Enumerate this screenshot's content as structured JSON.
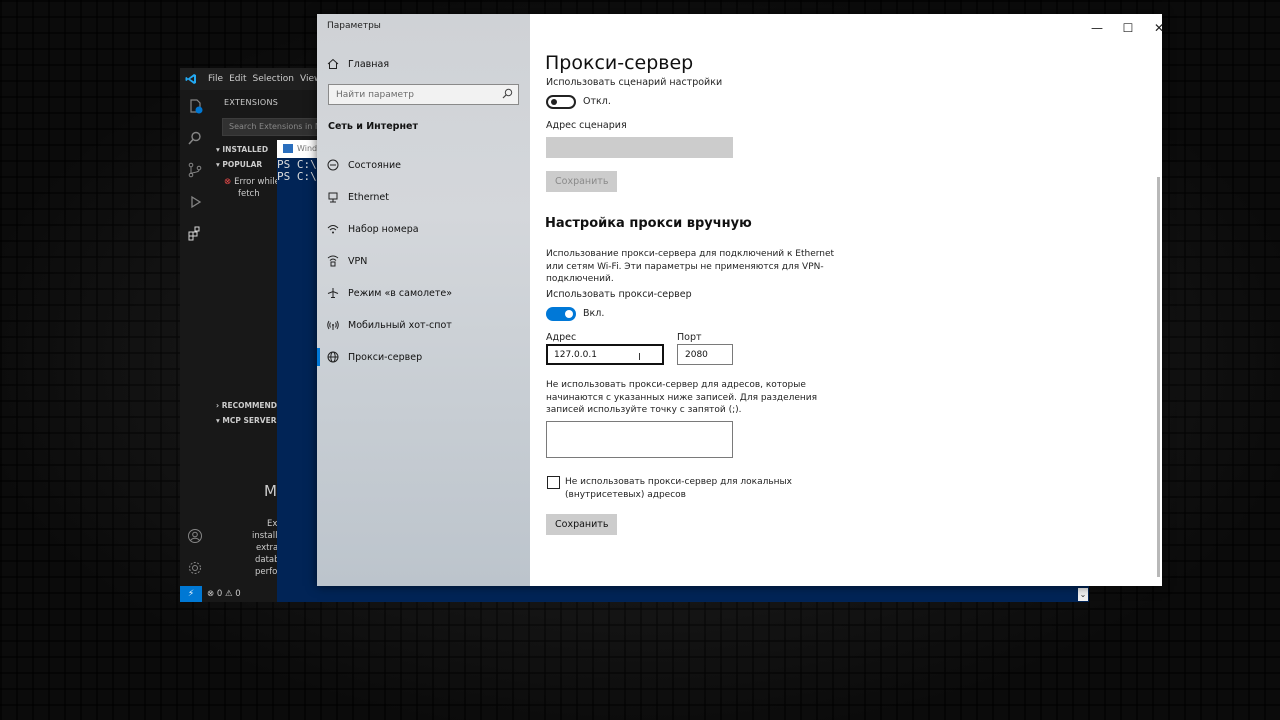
{
  "vscode": {
    "menu": [
      "File",
      "Edit",
      "Selection",
      "View"
    ],
    "extensions_title": "EXTENSIONS",
    "search_placeholder": "Search Extensions in M",
    "installed_label": "INSTALLED",
    "popular_label": "POPULAR",
    "error_line1": "Error while",
    "error_line2": "fetch",
    "recommended_label": "RECOMMENDED",
    "mcp_label": "MCP SERVERS",
    "frag_heading": "M",
    "frag_lines": [
      "Ext",
      "installi",
      "extra",
      "datab",
      "perfo"
    ],
    "status_errors": "0",
    "status_warnings": "0",
    "account_icon": "account-icon",
    "settings_icon": "gear-icon"
  },
  "powershell": {
    "tab_title": "Wind",
    "lines": "PS C:\\\nPS C:\\"
  },
  "settings": {
    "window_title": "Параметры",
    "home": "Главная",
    "search_placeholder": "Найти параметр",
    "category": "Сеть и Интернет",
    "nav_items": [
      {
        "label": "Состояние",
        "icon": "status-icon"
      },
      {
        "label": "Ethernet",
        "icon": "ethernet-icon"
      },
      {
        "label": "Набор номера",
        "icon": "dialup-icon"
      },
      {
        "label": "VPN",
        "icon": "vpn-icon"
      },
      {
        "label": "Режим «в самолете»",
        "icon": "airplane-icon"
      },
      {
        "label": "Мобильный хот-спот",
        "icon": "hotspot-icon"
      },
      {
        "label": "Прокси-сервер",
        "icon": "proxy-icon"
      }
    ],
    "selected_item": "Прокси-сервер",
    "page_title": "Прокси-сервер",
    "script_toggle_label": "Использовать сценарий настройки",
    "script_toggle_state": "Откл.",
    "script_address_label": "Адрес сценария",
    "script_save_button": "Сохранить",
    "manual_title": "Настройка прокси вручную",
    "manual_desc": "Использование прокси-сервера для подключений к Ethernet или сетям Wi-Fi. Эти параметры не применяются для VPN-подключений.",
    "use_proxy_label": "Использовать прокси-сервер",
    "use_proxy_state": "Вкл.",
    "address_label": "Адрес",
    "address_value": "127.0.0.1",
    "port_label": "Порт",
    "port_value": "2080",
    "exceptions_desc": "Не использовать прокси-сервер для адресов, которые начинаются с указанных ниже записей. Для разделения записей используйте точку с запятой (;).",
    "local_checkbox_label": "Не использовать прокси-сервер для локальных (внутрисетевых) адресов",
    "save_button": "Сохранить",
    "accent_color": "#0078d7"
  }
}
